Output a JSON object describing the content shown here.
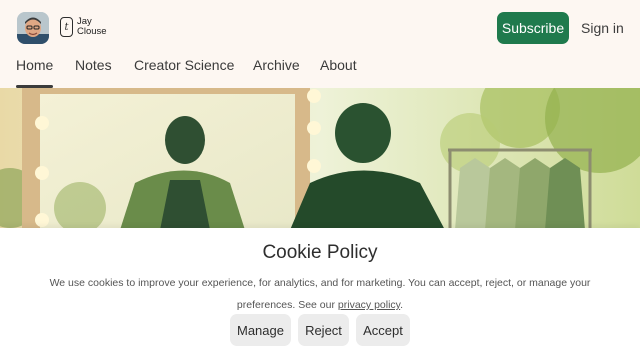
{
  "header": {
    "brand_line1": "Jay",
    "brand_line2": "Clouse",
    "brand_mark": "t",
    "subscribe_label": "Subscribe",
    "signin_label": "Sign in",
    "accent_color": "#1f7a4d"
  },
  "nav": {
    "tabs": [
      {
        "label": "Home",
        "active": true
      },
      {
        "label": "Notes",
        "active": false
      },
      {
        "label": "Creator Science",
        "active": false
      },
      {
        "label": "Archive",
        "active": false
      },
      {
        "label": "About",
        "active": false
      }
    ]
  },
  "cookie": {
    "title": "Cookie Policy",
    "text_line1": "We use cookies to improve your experience, for analytics, and for marketing. You can accept, reject, or manage your",
    "text_line2_prefix": "preferences. See our ",
    "privacy_link": "privacy policy",
    "text_line2_suffix": ".",
    "manage_label": "Manage",
    "reject_label": "Reject",
    "accept_label": "Accept"
  }
}
